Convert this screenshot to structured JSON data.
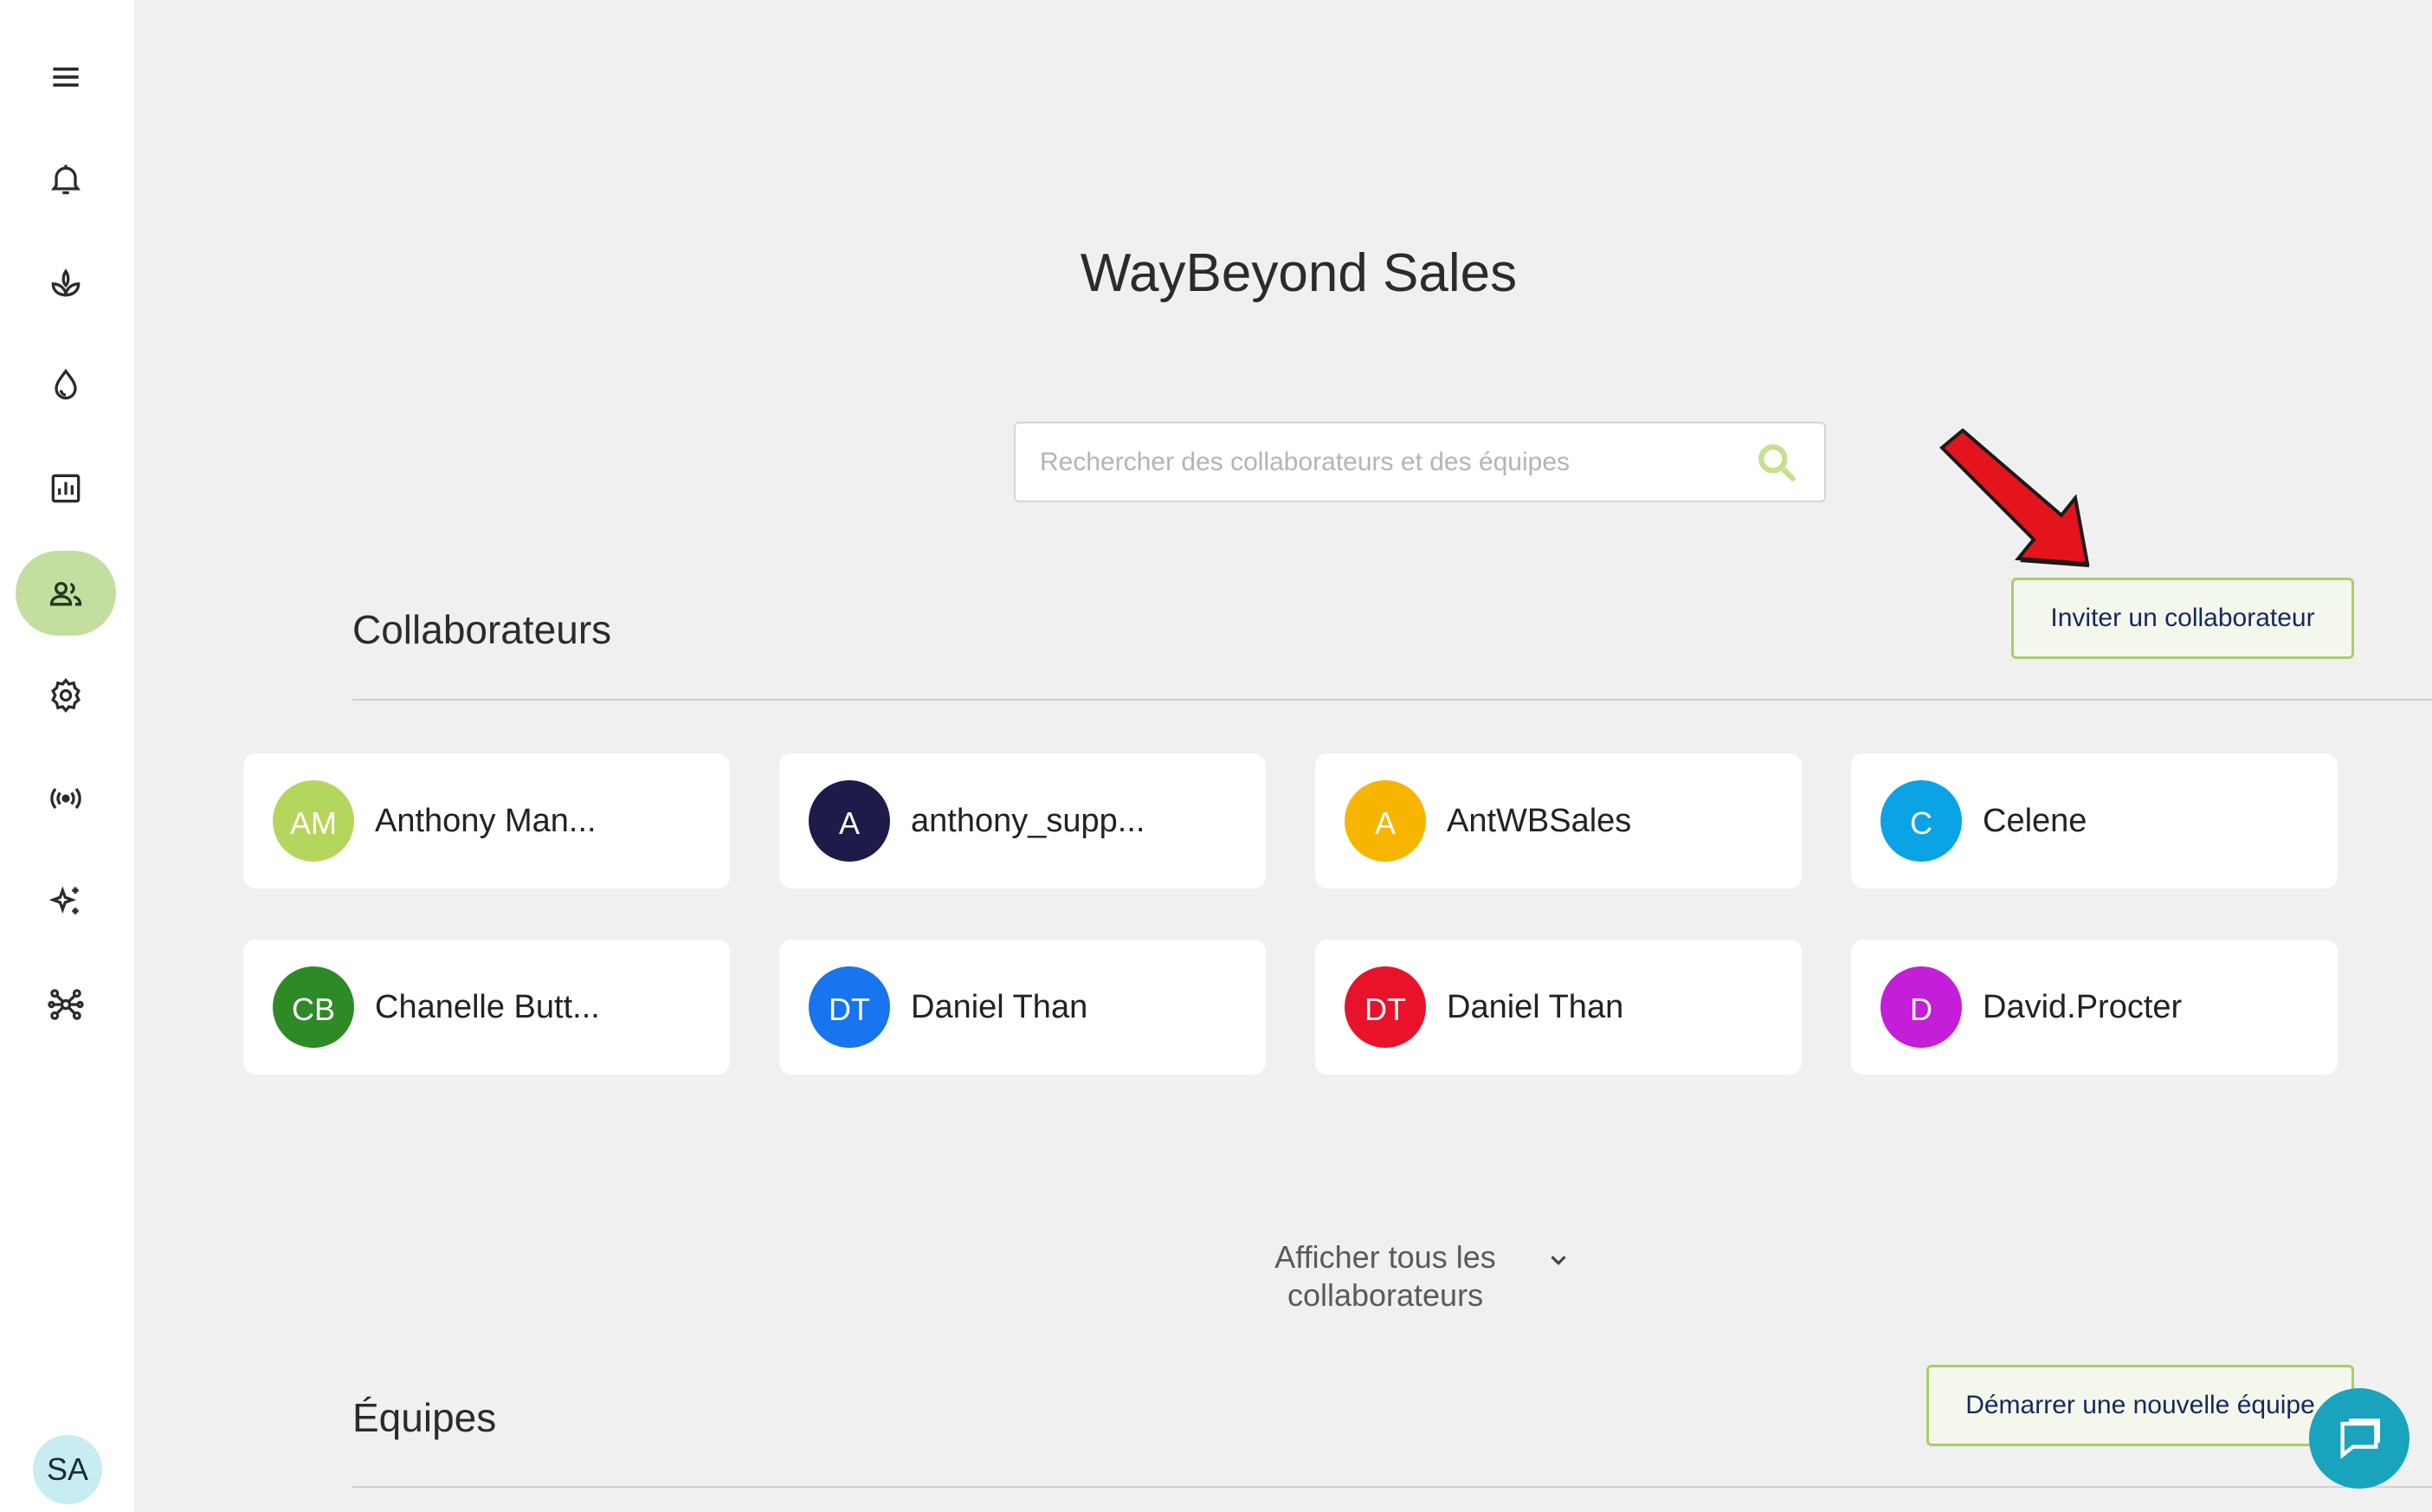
{
  "sidebar": {
    "items": [
      {
        "icon": "menu-icon"
      },
      {
        "icon": "bell-icon"
      },
      {
        "icon": "plant-icon"
      },
      {
        "icon": "water-drop-icon"
      },
      {
        "icon": "chart-icon"
      },
      {
        "icon": "users-icon",
        "active": true
      },
      {
        "icon": "gear-icon"
      },
      {
        "icon": "signal-icon"
      },
      {
        "icon": "sparkles-icon"
      },
      {
        "icon": "network-icon"
      }
    ],
    "user_initials": "SA"
  },
  "main": {
    "title": "WayBeyond Sales",
    "search": {
      "placeholder": "Rechercher des collaborateurs et des équipes"
    },
    "collaborators": {
      "heading": "Collaborateurs",
      "invite_label": "Inviter un collaborateur",
      "items": [
        {
          "initials": "AM",
          "name": "Anthony Man...",
          "color": "#b5d65c"
        },
        {
          "initials": "A",
          "name": "anthony_supp...",
          "color": "#1c1b4a"
        },
        {
          "initials": "A",
          "name": "AntWBSales",
          "color": "#f7b500"
        },
        {
          "initials": "C",
          "name": "Celene",
          "color": "#0aa3e6"
        },
        {
          "initials": "CB",
          "name": "Chanelle Butt...",
          "color": "#2e8a26"
        },
        {
          "initials": "DT",
          "name": "Daniel Than",
          "color": "#1874ef"
        },
        {
          "initials": "DT",
          "name": "Daniel Than",
          "color": "#e8132a"
        },
        {
          "initials": "D",
          "name": "David.Procter",
          "color": "#c41ed8"
        }
      ],
      "show_all_label": "Afficher tous les collaborateurs"
    },
    "teams": {
      "heading": "Équipes",
      "new_team_label": "Démarrer une nouvelle équipe"
    }
  },
  "colors": {
    "accent_green": "#a9cf68",
    "active_bg": "#c3dfa0",
    "chat": "#1aa3bd",
    "arrow": "#e3141c"
  }
}
